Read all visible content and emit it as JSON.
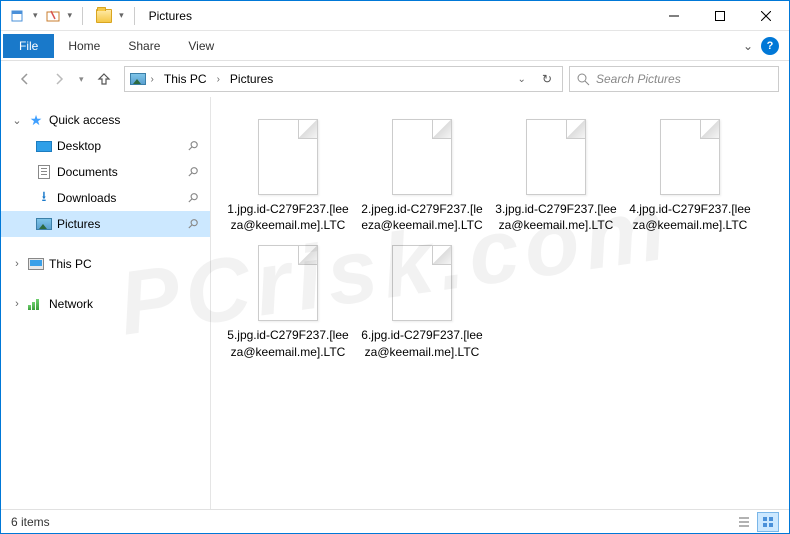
{
  "window": {
    "title": "Pictures"
  },
  "ribbon": {
    "file": "File",
    "tabs": [
      "Home",
      "Share",
      "View"
    ]
  },
  "address": {
    "segments": [
      "This PC",
      "Pictures"
    ]
  },
  "search": {
    "placeholder": "Search Pictures"
  },
  "sidebar": {
    "quick_access": "Quick access",
    "items": [
      {
        "label": "Desktop",
        "pinned": true
      },
      {
        "label": "Documents",
        "pinned": true
      },
      {
        "label": "Downloads",
        "pinned": true
      },
      {
        "label": "Pictures",
        "pinned": true,
        "selected": true
      }
    ],
    "this_pc": "This PC",
    "network": "Network"
  },
  "files": [
    "1.jpg.id-C279F237.[leeza@keemail.me].LTC",
    "2.jpeg.id-C279F237.[leeza@keemail.me].LTC",
    "3.jpg.id-C279F237.[leeza@keemail.me].LTC",
    "4.jpg.id-C279F237.[leeza@keemail.me].LTC",
    "5.jpg.id-C279F237.[leeza@keemail.me].LTC",
    "6.jpg.id-C279F237.[leeza@keemail.me].LTC"
  ],
  "status": {
    "count": "6 items"
  }
}
